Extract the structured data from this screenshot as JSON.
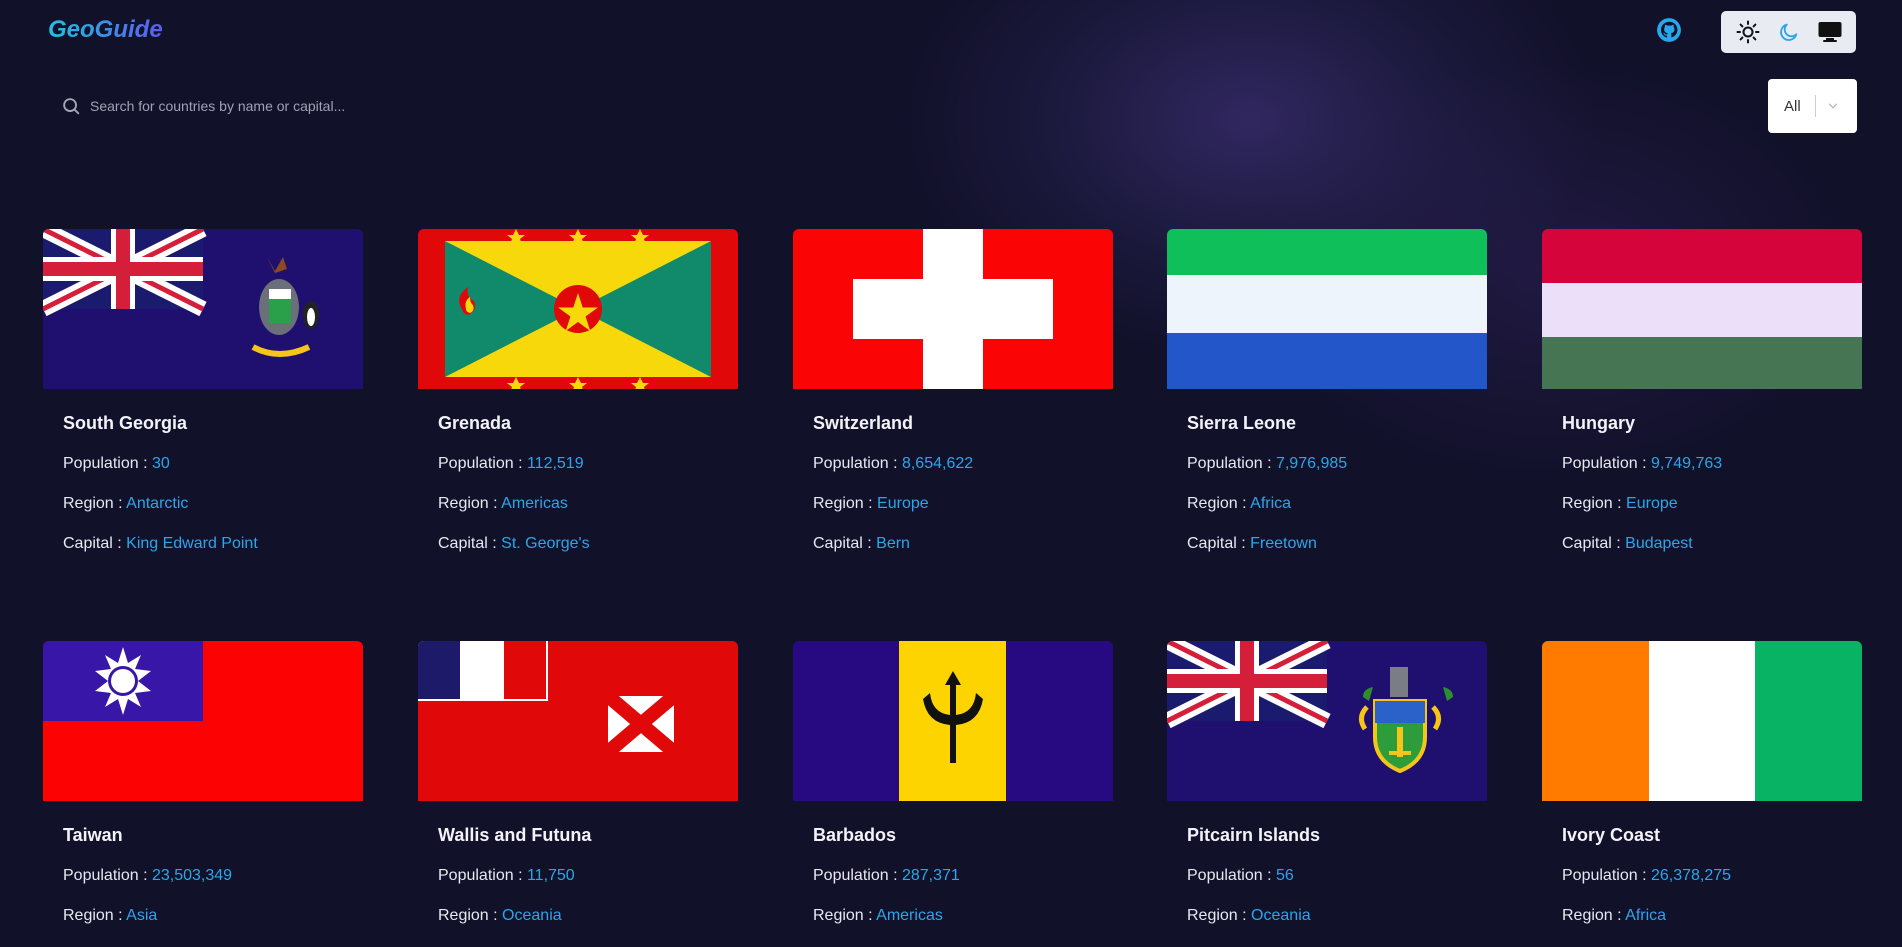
{
  "header": {
    "logo": "GeoGuide",
    "github_icon": "github-icon",
    "theme_options": [
      "sun-icon",
      "moon-icon",
      "monitor-icon"
    ]
  },
  "search": {
    "placeholder": "Search for countries by name or capital...",
    "value": ""
  },
  "filter": {
    "selected": "All",
    "icon": "chevron-down-icon"
  },
  "labels": {
    "population": "Population : ",
    "region": "Region : ",
    "capital": "Capital : "
  },
  "colors": {
    "background": "#12112a",
    "accent": "#2aa6ea"
  },
  "countries": [
    {
      "name": "South Georgia",
      "population": "30",
      "region": "Antarctic",
      "capital": "King Edward Point"
    },
    {
      "name": "Grenada",
      "population": "112,519",
      "region": "Americas",
      "capital": "St. George's"
    },
    {
      "name": "Switzerland",
      "population": "8,654,622",
      "region": "Europe",
      "capital": "Bern"
    },
    {
      "name": "Sierra Leone",
      "population": "7,976,985",
      "region": "Africa",
      "capital": "Freetown"
    },
    {
      "name": "Hungary",
      "population": "9,749,763",
      "region": "Europe",
      "capital": "Budapest"
    },
    {
      "name": "Taiwan",
      "population": "23,503,349",
      "region": "Asia",
      "capital": ""
    },
    {
      "name": "Wallis and Futuna",
      "population": "11,750",
      "region": "Oceania",
      "capital": ""
    },
    {
      "name": "Barbados",
      "population": "287,371",
      "region": "Americas",
      "capital": ""
    },
    {
      "name": "Pitcairn Islands",
      "population": "56",
      "region": "Oceania",
      "capital": ""
    },
    {
      "name": "Ivory Coast",
      "population": "26,378,275",
      "region": "Africa",
      "capital": ""
    }
  ]
}
